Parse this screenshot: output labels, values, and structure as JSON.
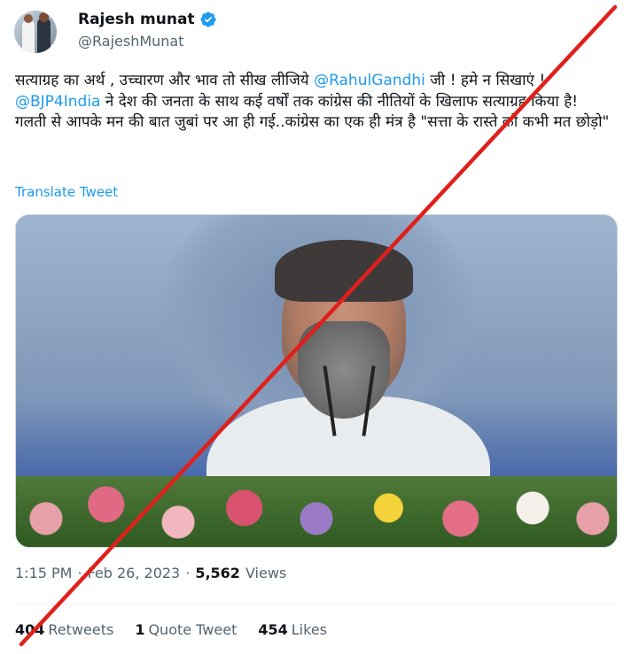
{
  "author": {
    "name": "Rajesh munat",
    "handle": "@RajeshMunat",
    "verified": true,
    "verified_icon": "verified-badge-icon",
    "avatar_icon": "avatar"
  },
  "more_icon": "more-options-icon",
  "tweet": {
    "line1_pre": "सत्याग्रह का अर्थ , उच्चारण और भाव तो सीख लीजिये ",
    "mention1": "@RahulGandhi",
    "line1_post": " जी ! हमे न सिखाएं ! ",
    "mention2": "@BJP4India",
    "line2_post": "  ने देश की जनता के साथ कई वर्षों तक कांग्रेस की नीतियों के खिलाफ सत्याग्रह किया है!",
    "line3": "गलती से आपके मन की बात जुबां पर आ ही गई..कांग्रेस का एक ही मंत्र है \"सत्ता के रास्ते को कभी मत छोड़ो\""
  },
  "translate_label": "Translate Tweet",
  "meta": {
    "time": "1:15 PM",
    "sep1": "·",
    "date": "Feb 26, 2023",
    "sep2": "·",
    "views_count": "5,562",
    "views_label": "Views"
  },
  "stats": {
    "retweets_count": "404",
    "retweets_label": "Retweets",
    "quotes_count": "1",
    "quotes_label": "Quote Tweet",
    "likes_count": "454",
    "likes_label": "Likes"
  },
  "colors": {
    "accent": "#1d9bf0",
    "text": "#0f1419",
    "muted": "#536471",
    "strike": "#e0201b"
  }
}
